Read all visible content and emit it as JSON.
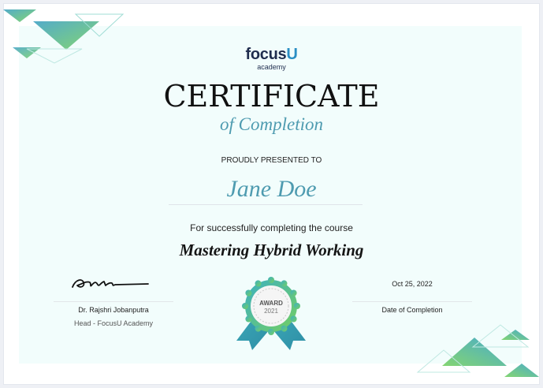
{
  "logo": {
    "brand_main": "focus",
    "brand_accent": "U",
    "brand_sub": "academy"
  },
  "certificate": {
    "title": "CERTIFICATE",
    "subtitle": "of Completion",
    "presented_label": "PROUDLY PRESENTED TO",
    "recipient_name": "Jane Doe",
    "completion_text": "For successfully completing the course",
    "course_name": "Mastering Hybrid Working"
  },
  "signatory": {
    "name": "Dr. Rajshri Jobanputra",
    "role": "Head - FocusU Academy"
  },
  "completion_date": {
    "value": "Oct 25, 2022",
    "label": "Date of Completion"
  },
  "badge": {
    "line1": "AWARD",
    "line2": "2021"
  },
  "colors": {
    "accent": "#4e9bb0",
    "teal": "#3fb6a8",
    "navy": "#1f2d4e",
    "background": "#f2fdfc"
  },
  "icons": [
    "decor-triangles-icon",
    "signature-icon",
    "award-ribbon-icon"
  ]
}
